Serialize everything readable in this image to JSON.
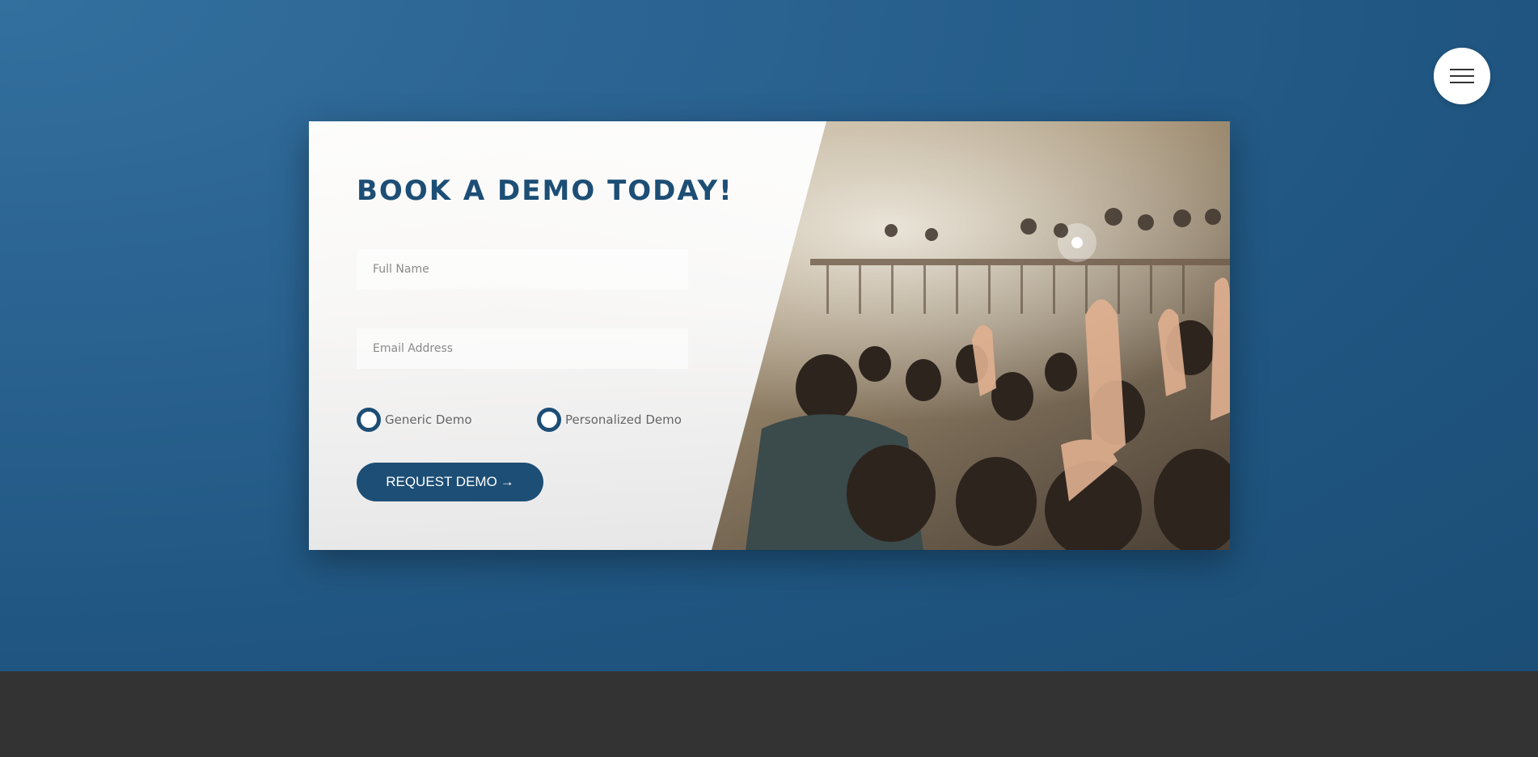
{
  "header": {
    "menu_icon": "hamburger-menu-icon"
  },
  "form": {
    "title": "BOOK A DEMO TODAY!",
    "full_name": {
      "value": "",
      "placeholder": "Full Name"
    },
    "email": {
      "value": "",
      "placeholder": "Email Address"
    },
    "demo_options": [
      {
        "label": "Generic Demo",
        "selected": false
      },
      {
        "label": "Personalized Demo",
        "selected": false
      }
    ],
    "submit_label": "REQUEST DEMO",
    "submit_arrow": "→"
  },
  "media": {
    "photo": "concert-crowd-photo"
  },
  "colors": {
    "accent": "#1d4e75",
    "background": "#2a6290",
    "footer": "#333333",
    "card": "#ffffff"
  }
}
